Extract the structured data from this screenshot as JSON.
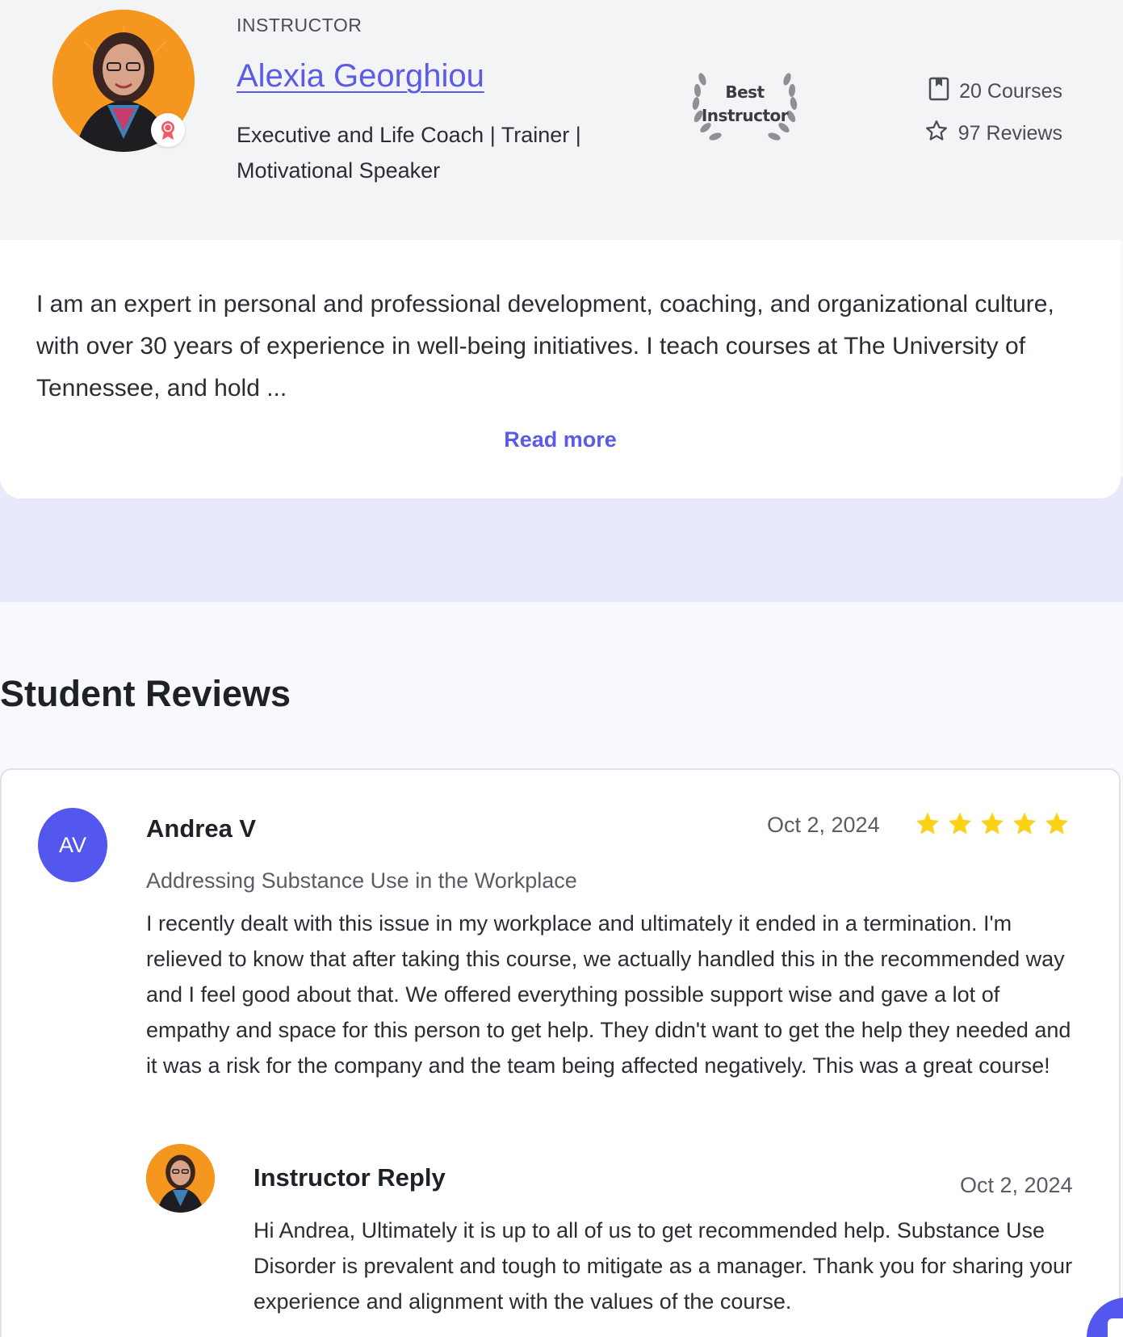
{
  "instructor": {
    "kicker": "INSTRUCTOR",
    "name": "Alexia Georghiou",
    "title": "Executive and Life Coach | Trainer | Motivational Speaker",
    "badge_line1": "Best",
    "badge_line2": "Instructor",
    "courses": "20 Courses",
    "reviews": "97 Reviews",
    "about": "I am an expert in personal and professional development, coaching, and organizational culture, with over 30 years of experience in well-being initiatives. I teach courses at The University of Tennessee, and hold ...",
    "read_more": "Read more"
  },
  "reviews_section": {
    "heading": "Student Reviews",
    "review": {
      "initials": "AV",
      "name": "Andrea V",
      "date": "Oct 2, 2024",
      "rating": 5,
      "course": "Addressing Substance Use in the Workplace",
      "body": "I recently dealt with this issue in my workplace and ultimately it ended in a termination. I'm relieved to know that after taking this course, we actually handled this in the recommended way and I feel good about that. We offered everything possible support wise and gave a lot of empathy and space for this person to get help. They didn't want to get the help they needed and it was a risk for the company and the team being affected negatively. This was a great course!",
      "reply": {
        "title": "Instructor Reply",
        "date": "Oct 2, 2024",
        "body": "Hi Andrea, Ultimately it is up to all of us to get recommended help. Substance Use Disorder is prevalent and tough to mitigate as a manager. Thank you for sharing your experience and alignment with the values of the course."
      }
    }
  },
  "colors": {
    "accent": "#5b5be8",
    "avatar_bg": "#5457ee",
    "photo_bg": "#f5961f",
    "star": "#fcd116"
  },
  "icons": {
    "courses": "book-icon",
    "reviews": "star-outline-icon",
    "award": "award-ribbon-icon",
    "rating": "star-filled-icon",
    "chat": "chat-bubble-icon"
  }
}
